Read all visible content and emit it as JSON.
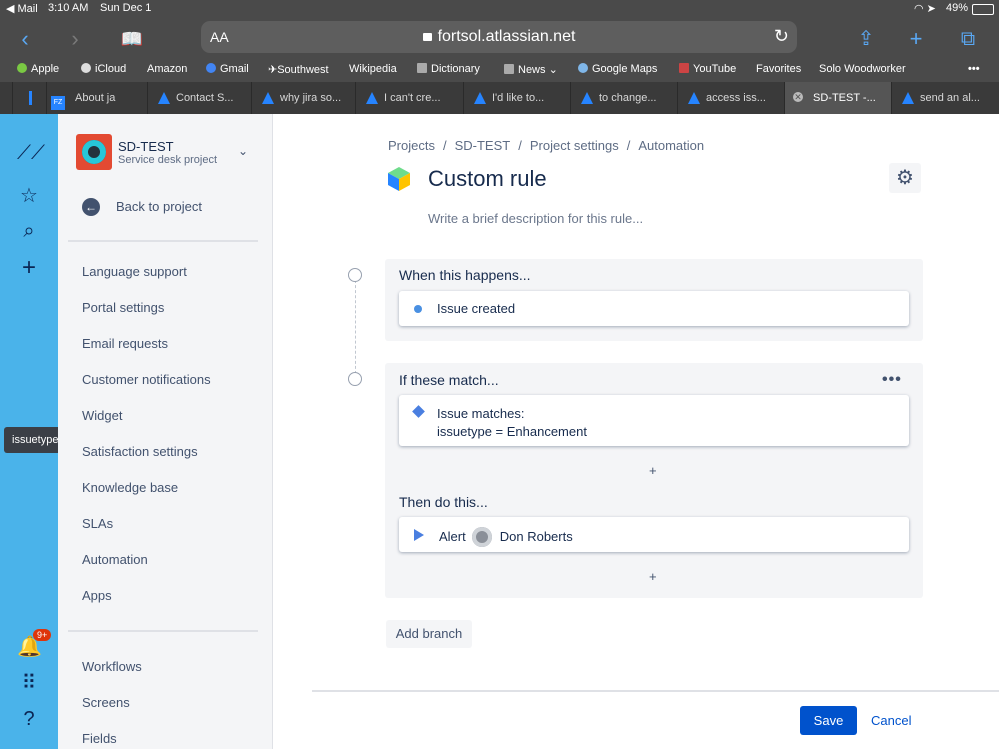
{
  "status_bar": {
    "back_app": "◀ Mail",
    "time": "3:10 AM",
    "date": "Sun Dec 1",
    "battery": "49%"
  },
  "browser": {
    "url": "fortsol.atlassian.net",
    "text_size": "AA",
    "bookmarks": [
      "Apple",
      "iCloud",
      "Amazon",
      "Gmail",
      "Southwest",
      "Wikipedia",
      "Dictionary",
      "News",
      "Google Maps",
      "YouTube",
      "Favorites",
      "Solo Woodworker"
    ],
    "tabs": [
      "About ja",
      "Contact S...",
      "why jira so...",
      "I can't cre...",
      "I'd like to...",
      "to change...",
      "access iss...",
      "SD-TEST -...",
      "send an al..."
    ]
  },
  "rail": {
    "tooltip": "issuetype",
    "notification_count": "9+"
  },
  "sidebar": {
    "project_name": "SD-TEST",
    "project_type": "Service desk project",
    "back_label": "Back to project",
    "items": [
      "Language support",
      "Portal settings",
      "Email requests",
      "Customer notifications",
      "Widget",
      "Satisfaction settings",
      "Knowledge base",
      "SLAs",
      "Automation",
      "Apps"
    ],
    "items2": [
      "Workflows",
      "Screens",
      "Fields"
    ]
  },
  "breadcrumbs": [
    "Projects",
    "SD-TEST",
    "Project settings",
    "Automation"
  ],
  "rule": {
    "title": "Custom rule",
    "description_placeholder": "Write a brief description for this rule...",
    "when_title": "When this happens...",
    "trigger": "Issue created",
    "if_title": "If these match...",
    "condition_line1": "Issue matches:",
    "condition_line2": "issuetype = Enhancement",
    "then_title": "Then do this...",
    "action_label": "Alert",
    "action_user": "Don Roberts",
    "plus": "+",
    "more": "•••"
  },
  "footer": {
    "add_branch": "Add branch",
    "save": "Save",
    "cancel": "Cancel"
  }
}
